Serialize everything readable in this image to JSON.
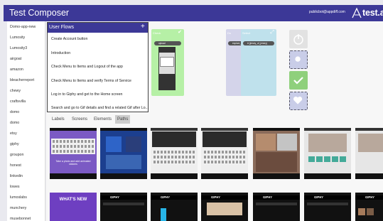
{
  "header": {
    "title": "Test Composer",
    "email": "publicbot@appdiff.com",
    "logo_text": "test.ai"
  },
  "sidebar": {
    "items": [
      "Domo-app-new",
      "Lumosity",
      "Lumosity3",
      "airgoat",
      "amazon",
      "bleacherreport",
      "chewy",
      "craftsvilla",
      "domo",
      "domo",
      "etsy",
      "giphy",
      "groupon",
      "honest",
      "linkedin",
      "lowes",
      "lumoslabs",
      "munchery",
      "musebonnet"
    ]
  },
  "flows": {
    "title": "User Flows",
    "add_icon": "plus-icon",
    "items": [
      "Create Account button",
      "Introduction",
      "Check Menu to Items and Logout of the app",
      "Check Menu to Items and verify Terms of Service",
      "Log in to Giphy and get to the Home screen",
      "Search and go to Gif details and find a related Gif after Lo..."
    ]
  },
  "graph": {
    "cards": [
      {
        "label": "Check",
        "pill": "upload",
        "color": "#b6f0a6",
        "status": "check-icon"
      },
      {
        "label": "Do",
        "pill": "explore_log",
        "color": "#d4d4ea",
        "status": "expand-icon"
      },
      {
        "label": "Select",
        "pill": "# (jersey_of_jersey)",
        "color": "#bfe1ec",
        "status": "expand-icon"
      }
    ],
    "actions": [
      {
        "icon": "power-icon",
        "color": "#e2e2e2"
      },
      {
        "icon": "touch-icon",
        "color": "#c9cde8"
      },
      {
        "icon": "check-icon",
        "color": "#8fd07c"
      },
      {
        "icon": "heart-icon",
        "color": "#c9cde8"
      }
    ]
  },
  "tabs": {
    "items": [
      "Labels",
      "Screens",
      "Elements",
      "Paths"
    ],
    "active": "Paths"
  },
  "thumbs": {
    "giphy_label": "GIPHY",
    "whats_new": "WHAT'S NEW",
    "caption": "Take a photo and add animated stickers"
  }
}
